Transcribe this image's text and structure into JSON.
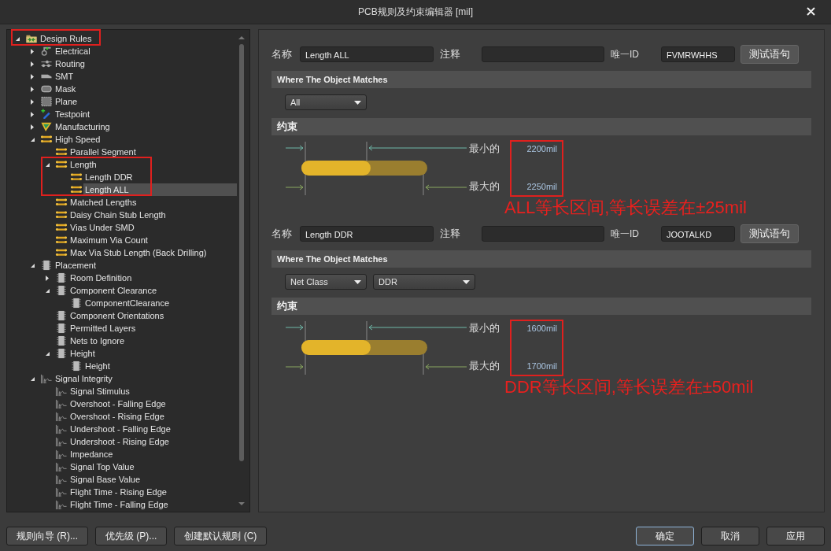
{
  "window": {
    "title": "PCB规则及约束编辑器 [mil]"
  },
  "tree": [
    {
      "label": "Design Rules",
      "kind": "folder",
      "expanded": true,
      "selected": false,
      "boxed": true,
      "boxed_with_children": false,
      "children": [
        {
          "label": "Electrical",
          "kind": "electrical",
          "expanded": false,
          "selected": false
        },
        {
          "label": "Routing",
          "kind": "routing",
          "expanded": false,
          "selected": false
        },
        {
          "label": "SMT",
          "kind": "smt",
          "expanded": false,
          "selected": false
        },
        {
          "label": "Mask",
          "kind": "mask",
          "expanded": false,
          "selected": false
        },
        {
          "label": "Plane",
          "kind": "plane",
          "expanded": false,
          "selected": false
        },
        {
          "label": "Testpoint",
          "kind": "testpoint",
          "expanded": false,
          "selected": false
        },
        {
          "label": "Manufacturing",
          "kind": "manufacturing",
          "expanded": false,
          "selected": false
        },
        {
          "label": "High Speed",
          "kind": "highspeed",
          "expanded": true,
          "selected": false,
          "children": [
            {
              "label": "Parallel Segment",
              "kind": "highspeed",
              "selected": false
            },
            {
              "label": "Length",
              "kind": "highspeed",
              "expanded": true,
              "selected": false,
              "boxed": true,
              "boxed_with_children": true,
              "children": [
                {
                  "label": "Length DDR",
                  "kind": "highspeed",
                  "selected": false
                },
                {
                  "label": "Length ALL",
                  "kind": "highspeed",
                  "selected": true
                }
              ]
            },
            {
              "label": "Matched Lengths",
              "kind": "highspeed",
              "selected": false
            },
            {
              "label": "Daisy Chain Stub Length",
              "kind": "highspeed",
              "selected": false
            },
            {
              "label": "Vias Under SMD",
              "kind": "highspeed",
              "selected": false
            },
            {
              "label": "Maximum Via Count",
              "kind": "highspeed",
              "selected": false
            },
            {
              "label": "Max Via Stub Length (Back Drilling)",
              "kind": "highspeed",
              "selected": false
            }
          ]
        },
        {
          "label": "Placement",
          "kind": "placement",
          "expanded": true,
          "selected": false,
          "children": [
            {
              "label": "Room Definition",
              "kind": "placement",
              "expanded": false,
              "selected": false
            },
            {
              "label": "Component Clearance",
              "kind": "placement",
              "expanded": true,
              "selected": false,
              "children": [
                {
                  "label": "ComponentClearance",
                  "kind": "placement",
                  "selected": false
                }
              ]
            },
            {
              "label": "Component Orientations",
              "kind": "placement",
              "selected": false
            },
            {
              "label": "Permitted Layers",
              "kind": "placement",
              "selected": false
            },
            {
              "label": "Nets to Ignore",
              "kind": "placement",
              "selected": false
            },
            {
              "label": "Height",
              "kind": "placement",
              "expanded": true,
              "selected": false,
              "children": [
                {
                  "label": "Height",
                  "kind": "placement",
                  "selected": false
                }
              ]
            }
          ]
        },
        {
          "label": "Signal Integrity",
          "kind": "signal",
          "expanded": true,
          "selected": false,
          "children": [
            {
              "label": "Signal Stimulus",
              "kind": "signal",
              "selected": false
            },
            {
              "label": "Overshoot - Falling Edge",
              "kind": "signal",
              "selected": false
            },
            {
              "label": "Overshoot - Rising Edge",
              "kind": "signal",
              "selected": false
            },
            {
              "label": "Undershoot - Falling Edge",
              "kind": "signal",
              "selected": false
            },
            {
              "label": "Undershoot - Rising Edge",
              "kind": "signal",
              "selected": false
            },
            {
              "label": "Impedance",
              "kind": "signal",
              "selected": false
            },
            {
              "label": "Signal Top Value",
              "kind": "signal",
              "selected": false
            },
            {
              "label": "Signal Base Value",
              "kind": "signal",
              "selected": false
            },
            {
              "label": "Flight Time - Rising Edge",
              "kind": "signal",
              "selected": false
            },
            {
              "label": "Flight Time - Falling Edge",
              "kind": "signal",
              "selected": false
            }
          ]
        }
      ]
    }
  ],
  "rules": [
    {
      "name_label": "名称",
      "name": "Length ALL",
      "comment_label": "注释",
      "id_label": "唯一ID",
      "unique_id": "FVMRWHHS",
      "test_button": "测试语句",
      "match_header": "Where The Object Matches",
      "match_dropdowns": [
        "All"
      ],
      "constraint_header": "约束",
      "min_label": "最小的",
      "min_value": "2200mil",
      "max_label": "最大的",
      "max_value": "2250mil",
      "note": "ALL等长区间,等长误差在±25mil"
    },
    {
      "name_label": "名称",
      "name": "Length DDR",
      "comment_label": "注释",
      "id_label": "唯一ID",
      "unique_id": "JOOTALKD",
      "test_button": "测试语句",
      "match_header": "Where The Object Matches",
      "match_dropdowns": [
        "Net Class",
        "DDR"
      ],
      "constraint_header": "约束",
      "min_label": "最小的",
      "min_value": "1600mil",
      "max_label": "最大的",
      "max_value": "1700mil",
      "note": "DDR等长区间,等长误差在±50mil"
    }
  ],
  "footer": {
    "left_buttons": [
      "规则向导 (R)...",
      "优先级 (P)...",
      "创建默认规则 (C)"
    ],
    "right_buttons": [
      {
        "label": "确定",
        "focused": true
      },
      {
        "label": "取消",
        "focused": false
      },
      {
        "label": "应用",
        "focused": false
      }
    ]
  }
}
